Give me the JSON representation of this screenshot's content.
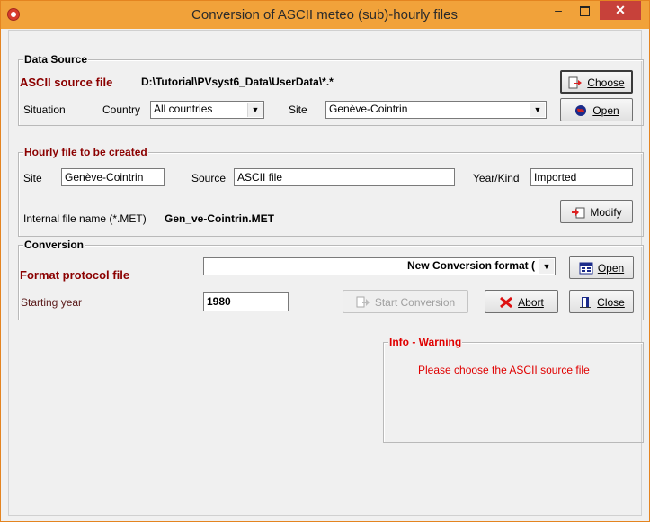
{
  "window": {
    "title": "Conversion of ASCII meteo (sub)-hourly files",
    "minimize_glyph": "–",
    "close_glyph": "✕"
  },
  "data_source": {
    "group_title": "Data Source",
    "source_label": "ASCII source file",
    "source_path": "D:\\Tutorial\\PVsyst6_Data\\UserData\\*.*",
    "choose_button": "Choose",
    "situation_label": "Situation",
    "country_label": "Country",
    "country_value": "All countries",
    "site_label": "Site",
    "site_value": "Genève-Cointrin",
    "open_button": "Open"
  },
  "hourly_file": {
    "group_title": "Hourly file to be created",
    "site_label": "Site",
    "site_value": "Genève-Cointrin",
    "source_label": "Source",
    "source_value": "ASCII file",
    "yearkind_label": "Year/Kind",
    "yearkind_value": "Imported",
    "internal_label": "Internal file name  (*.MET)",
    "internal_value": "Gen_ve-Cointrin.MET",
    "modify_button": "Modify"
  },
  "conversion": {
    "group_title": "Conversion",
    "format_label": "Format protocol file",
    "format_value": "New Conversion format (",
    "open_button": "Open",
    "starting_year_label": "Starting year",
    "starting_year_value": "1980",
    "start_button": "Start Conversion",
    "abort_button": "Abort",
    "close_button": "Close"
  },
  "info": {
    "group_title": "Info - Warning",
    "message": "Please choose the ASCII source file"
  },
  "colors": {
    "titlebar": "#f1a23a",
    "close_button": "#c7413a",
    "label_maroon": "#8b0000",
    "warning_red": "#e00000"
  },
  "icons": [
    "app-logo-icon",
    "choose-file-icon",
    "open-globe-icon",
    "modify-icon",
    "open-format-icon",
    "start-conversion-icon",
    "abort-x-icon",
    "close-door-icon",
    "chevron-down-icon"
  ]
}
